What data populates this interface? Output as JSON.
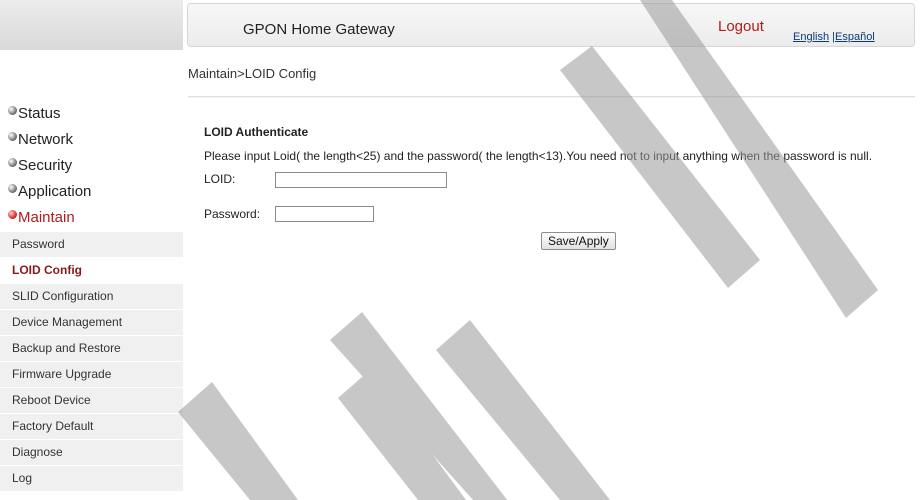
{
  "header": {
    "title": "GPON Home Gateway",
    "logout_label": "Logout",
    "lang_english": "English",
    "lang_separator": " |",
    "lang_spanish": "Español"
  },
  "breadcrumb": "Maintain>LOID Config",
  "sidebar": {
    "groups": [
      {
        "label": "Status"
      },
      {
        "label": "Network"
      },
      {
        "label": "Security"
      },
      {
        "label": "Application"
      },
      {
        "label": "Maintain"
      }
    ],
    "sub_items": [
      {
        "label": "Password"
      },
      {
        "label": "LOID Config"
      },
      {
        "label": "SLID Configuration"
      },
      {
        "label": "Device Management"
      },
      {
        "label": "Backup and Restore"
      },
      {
        "label": "Firmware Upgrade"
      },
      {
        "label": "Reboot Device"
      },
      {
        "label": "Factory Default"
      },
      {
        "label": "Diagnose"
      },
      {
        "label": "Log"
      }
    ]
  },
  "form": {
    "section_title": "LOID Authenticate",
    "instructions": "Please input Loid( the length<25) and the password( the length<13).You need not to input anything when the password is null.",
    "loid_label": "LOID:",
    "loid_value": "",
    "password_label": "Password:",
    "password_value": "",
    "save_label": "Save/Apply"
  },
  "colors": {
    "accent": "#b31b1b",
    "active_sub_item": "#8a1a1a",
    "link_blue": "#0a3a7a"
  },
  "icons": {
    "nav_bullet": "sphere-bullet-icon",
    "nav_bullet_active": "red-sphere-bullet-icon"
  }
}
